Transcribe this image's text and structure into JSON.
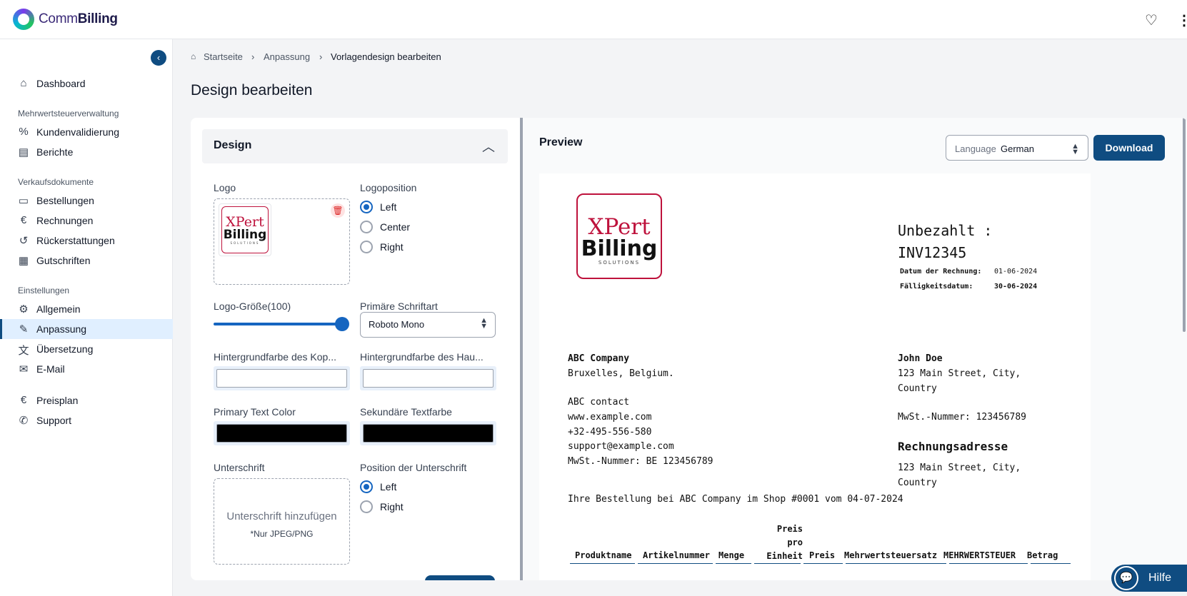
{
  "app": {
    "brand_prefix": "Comm",
    "brand_suffix": "Billing",
    "heart_icon": "heart-icon",
    "menu_icon": "more-vertical-icon"
  },
  "sidebar": {
    "items": [
      {
        "icon": "home-icon",
        "label": "Dashboard"
      },
      {
        "icon": "percent-doc-icon",
        "label": "Kundenvalidierung"
      },
      {
        "icon": "document-icon",
        "label": "Berichte"
      },
      {
        "icon": "inbox-icon",
        "label": "Bestellungen"
      },
      {
        "icon": "euro-doc-icon",
        "label": "Rechnungen"
      },
      {
        "icon": "refund-icon",
        "label": "Rückerstattungen"
      },
      {
        "icon": "credit-note-icon",
        "label": "Gutschriften"
      },
      {
        "icon": "gear-icon",
        "label": "Allgemein"
      },
      {
        "icon": "palette-doc-icon",
        "label": "Anpassung"
      },
      {
        "icon": "translate-icon",
        "label": "Übersetzung"
      },
      {
        "icon": "mail-icon",
        "label": "E-Mail"
      },
      {
        "icon": "euro-circle-icon",
        "label": "Preisplan"
      },
      {
        "icon": "chat-icon",
        "label": "Support"
      }
    ],
    "groups": [
      "Mehrwertsteuerverwaltung",
      "Verkaufsdokumente",
      "Einstellungen"
    ],
    "active": "Anpassung"
  },
  "breadcrumb": [
    "Startseite",
    "Anpassung",
    "Vorlagendesign bearbeiten"
  ],
  "page_title": "Design bearbeiten",
  "design": {
    "section_title": "Design",
    "logo_label": "Logo",
    "logo_position_label": "Logoposition",
    "logo_positions": [
      "Left",
      "Center",
      "Right"
    ],
    "logo_position_selected": "Left",
    "logo_size_label": "Logo-Größe(100)",
    "logo_size_value": 100,
    "font_label": "Primäre Schriftart",
    "font_value": "Roboto Mono",
    "header_bg_label": "Hintergrundfarbe des Kop...",
    "body_bg_label": "Hintergrundfarbe des Hau...",
    "primary_text_label": "Primary Text Color",
    "secondary_text_label": "Sekundäre Textfarbe",
    "header_bg_color": "#ffffff",
    "body_bg_color": "#ffffff",
    "primary_text_color": "#000000",
    "secondary_text_color": "#000000",
    "signature_label": "Unterschrift",
    "signature_position_label": "Position der Unterschrift",
    "signature_positions": [
      "Left",
      "Right"
    ],
    "signature_position_selected": "Left",
    "signature_add": "Unterschrift hinzufügen",
    "signature_hint": "*Nur JPEG/PNG"
  },
  "logo_art": {
    "line1": "XPert",
    "line2": "Billing",
    "line3": "SOLUTIONS"
  },
  "preview": {
    "title": "Preview",
    "language_label": "Language",
    "language_value": "German",
    "download_label": "Download"
  },
  "invoice": {
    "status_line": "Unbezahlt :",
    "number": "INV12345",
    "date_label": "Datum der Rechnung:",
    "date_value": "01-06-2024",
    "due_label": "Fälligkeitsdatum:",
    "due_value": "30-06-2024",
    "seller": [
      "ABC Company",
      "Bruxelles, Belgium.",
      "",
      "ABC contact",
      "www.example.com",
      "+32-495-556-580",
      "support@example.com",
      "MwSt.-Nummer: BE 123456789"
    ],
    "buyer_name": "John Doe",
    "buyer_address": [
      "123 Main Street, City,",
      "Country"
    ],
    "buyer_vat": "MwSt.-Nummer: 123456789",
    "billing_title": "Rechnungsadresse",
    "billing_address": [
      "123 Main Street, City,",
      "Country"
    ],
    "order_line": "Ihre Bestellung bei ABC Company im Shop #0001 vom 04-07-2024",
    "columns": [
      "Produktname",
      "Artikelnummer",
      "Menge",
      "Preis pro Einheit",
      "Preis",
      "Mehrwertsteuersatz",
      "MEHRWERTSTEUER",
      "Betrag"
    ],
    "col_unit_price_lines": [
      "Preis",
      "pro",
      "Einheit"
    ]
  },
  "help": {
    "label": "Hilfe",
    "icon": "chat-bubbles-icon"
  }
}
